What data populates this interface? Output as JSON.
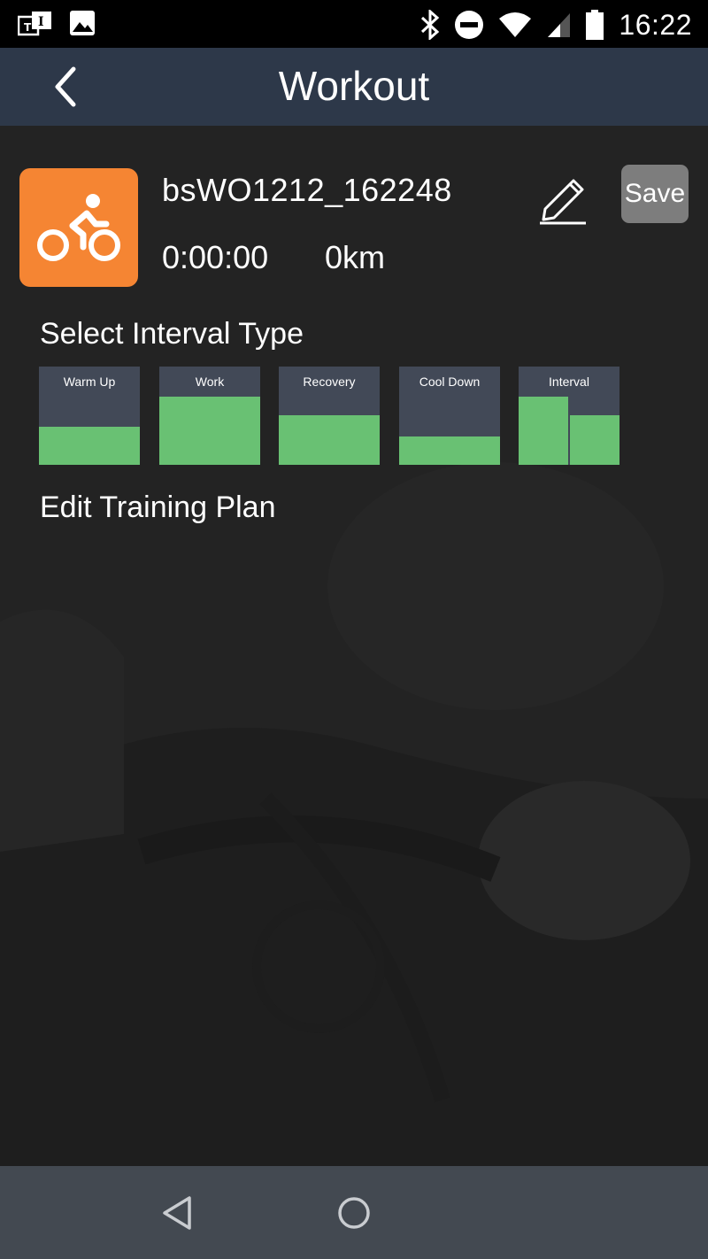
{
  "status_bar": {
    "time": "16:22",
    "icons": [
      "notification-ti-icon",
      "gallery-icon",
      "bluetooth-icon",
      "do-not-disturb-icon",
      "wifi-icon",
      "cellular-signal-icon",
      "battery-icon"
    ]
  },
  "app_bar": {
    "title": "Workout",
    "back_icon": "chevron-left-icon"
  },
  "workout": {
    "name": "bsWO1212_162248",
    "duration": "0:00:00",
    "distance": "0km",
    "icon": "cycling-icon",
    "edit_icon": "pencil-icon",
    "save_label": "Save"
  },
  "interval_section": {
    "title": "Select Interval Type",
    "types": [
      {
        "label": "Warm Up",
        "levels": [
          0.39
        ]
      },
      {
        "label": "Work",
        "levels": [
          0.69
        ]
      },
      {
        "label": "Recovery",
        "levels": [
          0.5
        ]
      },
      {
        "label": "Cool Down",
        "levels": [
          0.29
        ]
      },
      {
        "label": "Interval",
        "levels": [
          0.69,
          0.5
        ]
      }
    ]
  },
  "plan_section": {
    "title": "Edit Training Plan"
  },
  "colors": {
    "accent_orange": "#f58533",
    "interval_green": "#69c173",
    "tile_background": "#424957",
    "app_bar": "#2d3849",
    "save_button": "#7d7d7d"
  },
  "nav_bar": {
    "icons": [
      "back-triangle-icon",
      "home-circle-icon"
    ]
  }
}
